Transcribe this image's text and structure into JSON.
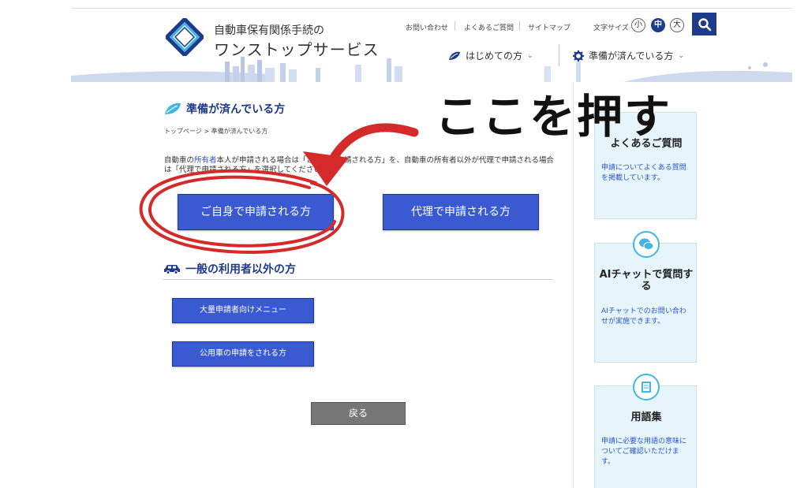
{
  "header": {
    "logo_line1": "自動車保有関係手続の",
    "logo_line2": "ワンストップサービス",
    "util_links": [
      "お問い合わせ",
      "よくあるご質問",
      "サイトマップ"
    ],
    "font_size_label": "文字サイズ",
    "font_sizes": [
      "小",
      "中",
      "大"
    ],
    "font_size_selected": "中",
    "search_icon": "search-icon",
    "nav": [
      {
        "label": "はじめての方",
        "icon": "leaf-icon"
      },
      {
        "label": "準備が済んでいる方",
        "icon": "gear-icon"
      }
    ]
  },
  "main": {
    "section_title": "準備が済んでいる方",
    "breadcrumb": {
      "home": "トップページ",
      "sep": ">",
      "current": "準備が済んでいる方"
    },
    "desc": {
      "p1": "自動車の",
      "link": "所有者",
      "p2": "本人が申請される場合は「ご自身で申請される方」を、自動車の所有者以外が代理で申請される場合は「代理で申請される方」を選択してください。"
    },
    "btn_self": "ご自身で申請される方",
    "btn_proxy": "代理で申請される方",
    "sub_title": "一般の利用者以外の方",
    "btn_bulk": "大量申請者向けメニュー",
    "btn_public": "公用車の申請をされる方",
    "btn_back": "戻る"
  },
  "sidebar": {
    "faq": {
      "title": "よくあるご質問",
      "text": "申請についてよくある質問を掲載しています。"
    },
    "ai": {
      "title": "AIチャットで質問する",
      "text": "AIチャットでのお問い合わせが実施できます。",
      "icon": "chat-icon"
    },
    "glossary": {
      "title": "用語集",
      "text": "申請に必要な用語の意味についてご確認いただけます。",
      "icon": "book-icon"
    }
  },
  "annotation": {
    "text": "ここを押す",
    "color": "#d42a2a"
  },
  "colors": {
    "primary": "#1e3a8a",
    "button": "#3a5ad1",
    "accent_cyan": "#41b6e6"
  }
}
